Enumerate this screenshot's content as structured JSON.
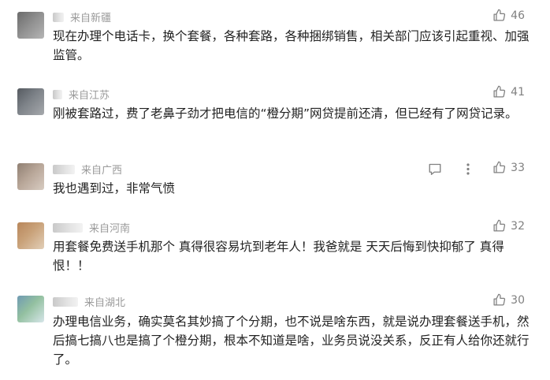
{
  "comments": [
    {
      "region": "来自新疆",
      "text": "现在办理个电话卡，换个套餐，各种套路，各种捆绑销售，相关部门应该引起重视、加强监管。",
      "likes": "46",
      "avatar_colors": [
        "#6b6b6b",
        "#8e8e8e",
        "#b5b5b5"
      ]
    },
    {
      "region": "来自江苏",
      "text": "刚被套路过，费了老鼻子劲才把电信的“橙分期”网贷提前还清，但已经有了网贷记录。",
      "likes": "41",
      "avatar_colors": [
        "#555a60",
        "#7d8288",
        "#a6a9ad"
      ]
    },
    {
      "region": "来自广西",
      "text": "我也遇到过，非常气愤",
      "likes": "33",
      "avatar_colors": [
        "#8f7f72",
        "#b7a597",
        "#d8ccc2"
      ],
      "show_actions": true
    },
    {
      "region": "来自河南",
      "text": "用套餐免费送手机那个 真得很容易坑到老年人！我爸就是 天天后悔到快抑郁了 真得恨！！",
      "likes": "32",
      "avatar_colors": [
        "#b8865a",
        "#c9a27a",
        "#e2cfb8"
      ]
    },
    {
      "region": "来自湖北",
      "text": "办理电信业务，确实莫名其妙搞了个分期，也不说是啥东西，就是说办理套餐送手机，然后搞七搞八也是搞了个橙分期，根本不知道是啥，业务员说没关系，反正有人给你还就行了。",
      "likes": "30",
      "avatar_colors": [
        "#6f9ab3",
        "#93c0a0",
        "#d7e6ea"
      ]
    }
  ],
  "colors": {
    "meta": "#9a9a9a",
    "text": "#222222",
    "icon": "#808080"
  }
}
